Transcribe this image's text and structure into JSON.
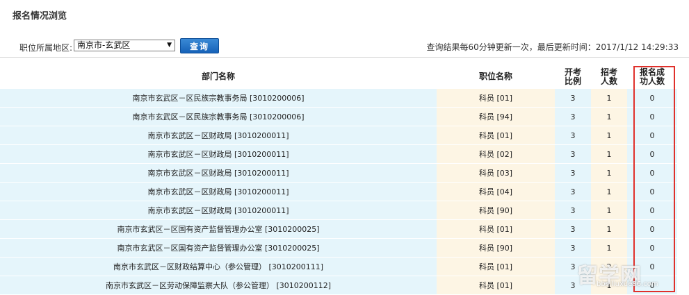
{
  "page_title": "报名情况浏览",
  "filter": {
    "region_label": "职位所属地区:",
    "region_value": "南京市-玄武区",
    "query_label": "查询"
  },
  "update_info": "查询结果每60分钟更新一次，最后更新时间：2017/1/12 14:29:33",
  "table": {
    "headers": {
      "dept": "部门名称",
      "position": "职位名称",
      "ratio_line1": "开考",
      "ratio_line2": "比例",
      "quota_line1": "招考",
      "quota_line2": "人数",
      "applied_line1": "报名成",
      "applied_line2": "功人数"
    },
    "rows": [
      {
        "dept": "南京市玄武区－区民族宗教事务局 [3010200006]",
        "position": "科员 [01]",
        "ratio": "3",
        "quota": "1",
        "applied": "0"
      },
      {
        "dept": "南京市玄武区－区民族宗教事务局 [3010200006]",
        "position": "科员 [94]",
        "ratio": "3",
        "quota": "1",
        "applied": "0"
      },
      {
        "dept": "南京市玄武区－区财政局 [3010200011]",
        "position": "科员 [01]",
        "ratio": "3",
        "quota": "1",
        "applied": "0"
      },
      {
        "dept": "南京市玄武区－区财政局 [3010200011]",
        "position": "科员 [02]",
        "ratio": "3",
        "quota": "1",
        "applied": "0"
      },
      {
        "dept": "南京市玄武区－区财政局 [3010200011]",
        "position": "科员 [03]",
        "ratio": "3",
        "quota": "1",
        "applied": "0"
      },
      {
        "dept": "南京市玄武区－区财政局 [3010200011]",
        "position": "科员 [04]",
        "ratio": "3",
        "quota": "1",
        "applied": "0"
      },
      {
        "dept": "南京市玄武区－区财政局 [3010200011]",
        "position": "科员 [90]",
        "ratio": "3",
        "quota": "1",
        "applied": "0"
      },
      {
        "dept": "南京市玄武区－区国有资产监督管理办公室 [3010200025]",
        "position": "科员 [01]",
        "ratio": "3",
        "quota": "1",
        "applied": "0"
      },
      {
        "dept": "南京市玄武区－区国有资产监督管理办公室 [3010200025]",
        "position": "科员 [90]",
        "ratio": "3",
        "quota": "1",
        "applied": "0"
      },
      {
        "dept": "南京市玄武区－区财政结算中心（参公管理） [3010200111]",
        "position": "科员 [01]",
        "ratio": "3",
        "quota": "2",
        "applied": "0"
      },
      {
        "dept": "南京市玄武区－区劳动保障监察大队（参公管理） [3010200112]",
        "position": "科员 [01]",
        "ratio": "3",
        "quota": "1",
        "applied": "0"
      }
    ]
  },
  "watermark": {
    "main": "留学网",
    "sub": "bbs.liuxue86.com"
  }
}
